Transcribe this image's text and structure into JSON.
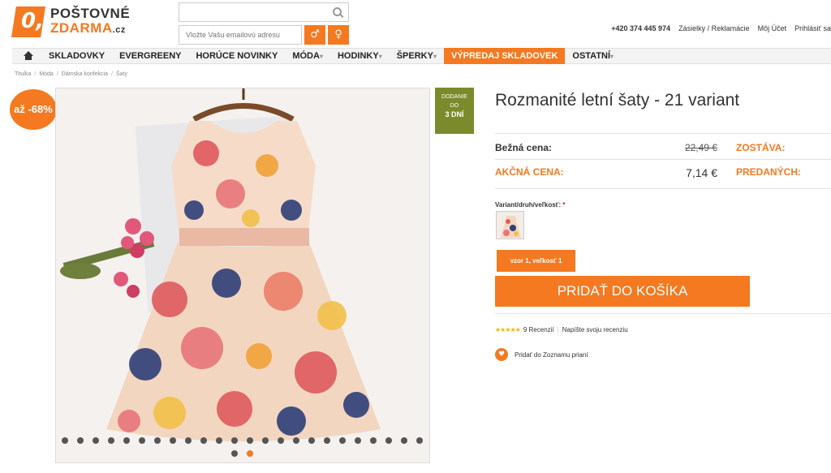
{
  "logo": {
    "mark": "0,",
    "line1": "POŠTOVNÉ",
    "line2": "ZDARMA",
    "tld": ".cz"
  },
  "search": {
    "placeholder": ""
  },
  "newsletter": {
    "placeholder": "Vložte Vašu emailovú adresu",
    "male_icon": "♂",
    "female_icon": "♀"
  },
  "top_links": {
    "phone": "+420 374 445 974",
    "shipments": "Zásielky / Reklamácie",
    "account": "Môj Účet",
    "login": "Prihlásiť sa"
  },
  "nav": {
    "items": [
      {
        "label": "SKLADOVKY",
        "caret": ""
      },
      {
        "label": "EVERGREENY",
        "caret": ""
      },
      {
        "label": "HORÚCE NOVINKY",
        "caret": ""
      },
      {
        "label": "MÓDA",
        "caret": "▾"
      },
      {
        "label": "HODINKY",
        "caret": "▾"
      },
      {
        "label": "ŠPERKY",
        "caret": "▾"
      },
      {
        "label": "VÝPREDAJ SKLADOVEK",
        "caret": ""
      },
      {
        "label": "OSTATNÍ",
        "caret": "▾"
      }
    ]
  },
  "breadcrumb": [
    "Titulka",
    "Móda",
    "Dámska konfekcia",
    "Šaty"
  ],
  "discount_badge": "až -68%",
  "delivery": {
    "line1": "DODANIE",
    "line2": "DO",
    "line3": "3 DNÍ"
  },
  "product": {
    "title": "Rozmanité letní šaty - 21 variant",
    "regular_label": "Bežná cena:",
    "regular_price": "22,49 €",
    "sale_label": "AKČNÁ CENA:",
    "sale_price": "7,14 €",
    "remaining_label": "ZOSTÁVA:",
    "sold_label": "PREDANÝCH:",
    "variant_label": "Variant/druh/veľkosť:",
    "variant_required": "*",
    "variant_selected": "vzor 1, veľkosť 1",
    "cart_button": "PRIDAŤ DO KOŠÍKA",
    "stars": "★★★★★",
    "reviews_count": "9 Recenzií",
    "write_review": "Napíšte svoju recenziu",
    "wishlist": "Pridať do Zoznamu prianí"
  },
  "gallery": {
    "dot_count": 25,
    "active_dot": 24
  },
  "colors": {
    "accent": "#f47920",
    "delivery": "#7b8b2b"
  }
}
